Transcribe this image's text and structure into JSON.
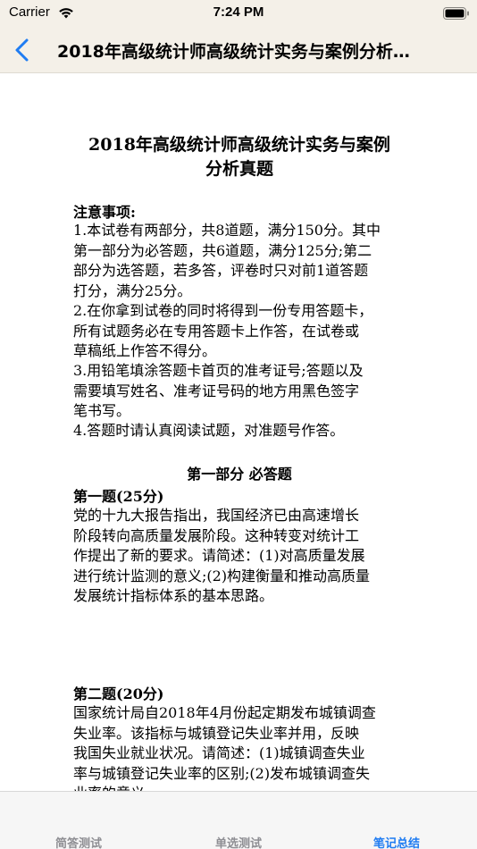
{
  "status_bar": {
    "carrier": "Carrier",
    "time": "7:24 PM",
    "icons": [
      "wifi-icon",
      "battery-icon"
    ]
  },
  "nav": {
    "back_icon": "chevron-left-icon",
    "title": "2018年高级统计师高级统计实务与案例分析…"
  },
  "document": {
    "title_line1": "2018年高级统计师高级统计实务与案例",
    "title_line2": "分析真题",
    "notes_heading": "注意事项:",
    "notes": [
      [
        "1.本试卷有两部分，共8道题，满分150分。其中",
        "第一部分为必答题，共6道题，满分125分;第二",
        "部分为选答题，若多答，评卷时只对前1道答题",
        "打分，满分25分。"
      ],
      [
        "2.在你拿到试卷的同时将得到一份专用答题卡，",
        "所有试题务必在专用答题卡上作答，在试卷或",
        "草稿纸上作答不得分。"
      ],
      [
        "3.用铅笔填涂答题卡首页的准考证号;答题以及",
        "需要填写姓名、准考证号码的地方用黑色签字",
        "笔书写。"
      ],
      [
        "4.答题时请认真阅读试题，对准题号作答。"
      ]
    ],
    "section_heading": "第一部分 必答题",
    "q1_heading": "第一题(25分)",
    "q1_text": [
      "党的十九大报告指出，我国经济已由高速增长",
      "阶段转向高质量发展阶段。这种转变对统计工",
      "作提出了新的要求。请简述：(1)对高质量发展",
      "进行统计监测的意义;(2)构建衡量和推动高质量",
      "发展统计指标体系的基本思路。"
    ],
    "q2_heading": "第二题(20分)",
    "q2_text": [
      "国家统计局自2018年4月份起定期发布城镇调查",
      "失业率。该指标与城镇登记失业率并用，反映",
      "我国失业就业状况。请简述：(1)城镇调查失业",
      "率与城镇登记失业率的区别;(2)发布城镇调查失",
      "业率的意义。"
    ]
  },
  "tabs": [
    {
      "label": "简答测试",
      "active": false
    },
    {
      "label": "单选测试",
      "active": false
    },
    {
      "label": "笔记总结",
      "active": true
    }
  ],
  "colors": {
    "bar_bg": "#f4f0e8",
    "accent": "#1f7cf2",
    "tab_inactive": "#8e8e93"
  }
}
